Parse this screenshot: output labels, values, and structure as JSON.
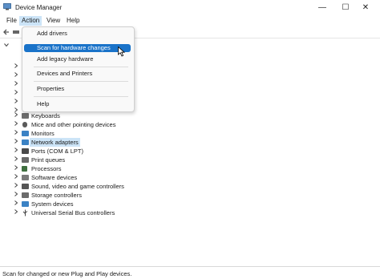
{
  "window": {
    "title": "Device Manager",
    "minimize_glyph": "—",
    "maximize_glyph": "☐",
    "close_glyph": "✕"
  },
  "menubar": {
    "items": [
      {
        "label": "File"
      },
      {
        "label": "Action",
        "active": true
      },
      {
        "label": "View"
      },
      {
        "label": "Help"
      }
    ]
  },
  "action_menu": {
    "items": [
      {
        "label": "Add drivers"
      },
      {
        "label": "Scan for hardware changes",
        "hover": true
      },
      {
        "label": "Add legacy hardware"
      },
      {
        "label": "Devices and Printers"
      },
      {
        "label": "Properties"
      },
      {
        "label": "Help"
      }
    ]
  },
  "tree": {
    "devices": [
      {
        "label": "Keyboards",
        "icon": "keyboard-icon",
        "color": "#6d6d6d"
      },
      {
        "label": "Mice and other pointing devices",
        "icon": "mouse-icon",
        "color": "#5a5a5a"
      },
      {
        "label": "Monitors",
        "icon": "monitor-icon",
        "color": "#3b82c4"
      },
      {
        "label": "Network adapters",
        "icon": "network-adapter-icon",
        "color": "#3b82c4",
        "selected": true
      },
      {
        "label": "Ports (COM & LPT)",
        "icon": "port-icon",
        "color": "#4a4a4a"
      },
      {
        "label": "Print queues",
        "icon": "printer-icon",
        "color": "#6a6a6a"
      },
      {
        "label": "Processors",
        "icon": "processor-icon",
        "color": "#3f6f3f"
      },
      {
        "label": "Software devices",
        "icon": "software-device-icon",
        "color": "#7a7a7a"
      },
      {
        "label": "Sound, video and game controllers",
        "icon": "speaker-icon",
        "color": "#555555"
      },
      {
        "label": "Storage controllers",
        "icon": "storage-controller-icon",
        "color": "#6b6b6b"
      },
      {
        "label": "System devices",
        "icon": "system-device-icon",
        "color": "#3b82c4"
      },
      {
        "label": "Universal Serial Bus controllers",
        "icon": "usb-icon",
        "color": "#444444"
      }
    ]
  },
  "status": {
    "text": "Scan for changed or new Plug and Play devices."
  },
  "colors": {
    "menu_highlight": "#1a73c9",
    "selection": "#cce4f7"
  }
}
